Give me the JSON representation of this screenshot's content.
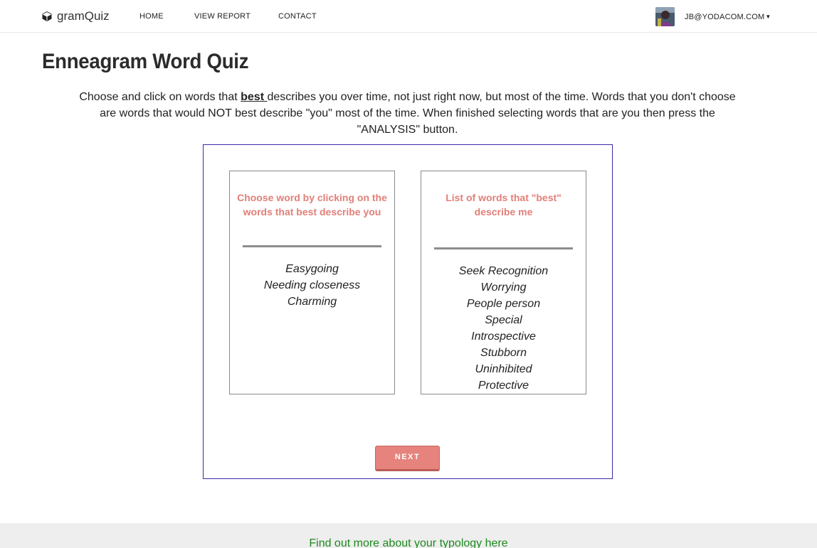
{
  "nav": {
    "brand": "gramQuiz",
    "links": [
      "HOME",
      "VIEW REPORT",
      "CONTACT"
    ],
    "user_email": "JB@YODACOM.COM"
  },
  "page": {
    "title": "Enneagram Word Quiz",
    "instructions_before": "Choose and click on words that ",
    "instructions_emphasis": "best ",
    "instructions_after": "describes you over time, not just right now, but most of the time. Words that you don't choose are words that would NOT best describe \"you\" most of the time. When finished selecting words that are you then press the \"ANALYSIS\" button."
  },
  "quiz": {
    "choose_panel": {
      "heading": "Choose word by clicking on the words that best describe you",
      "words": [
        "Easygoing",
        "Needing closeness",
        "Charming"
      ]
    },
    "selected_panel": {
      "heading": "List of words that \"best\" describe me",
      "words": [
        "Seek Recognition",
        "Worrying",
        "People person",
        "Special",
        "Introspective",
        "Stubborn",
        "Uninhibited",
        "Protective"
      ]
    },
    "next_label": "NEXT"
  },
  "footer": {
    "link_text": "Find out more about your typology here"
  },
  "colors": {
    "accent": "#e17f78",
    "quiz_border": "#3b2aa6",
    "footer_link": "#1e8a1e"
  }
}
